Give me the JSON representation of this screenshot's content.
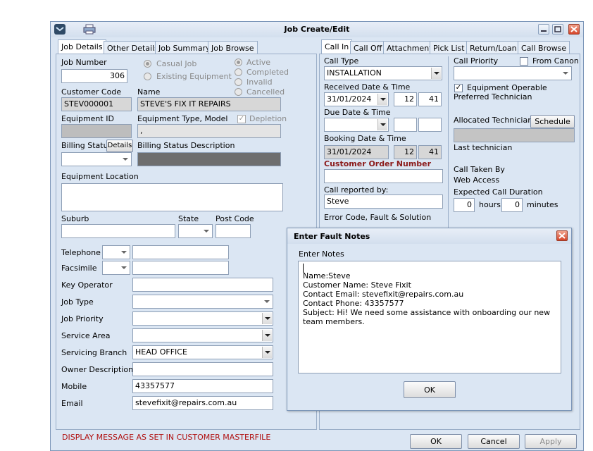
{
  "window": {
    "title": "Job Create/Edit"
  },
  "left_tabs": [
    "Job Details",
    "Other Details",
    "Job Summary",
    "Job Browse"
  ],
  "right_tabs": [
    "Call In",
    "Call Off",
    "Attachment",
    "Pick List",
    "Return/Loan",
    "Call Browse"
  ],
  "job": {
    "number_label": "Job Number",
    "number_value": "306",
    "job_kind": {
      "casual": "Casual Job",
      "existing": "Existing Equipment"
    },
    "status": {
      "active": "Active",
      "completed": "Completed",
      "invalid": "Invalid",
      "cancelled": "Cancelled"
    },
    "customer_code_label": "Customer Code",
    "customer_code_value": "STEV000001",
    "name_label": "Name",
    "name_value": "STEVE'S FIX IT REPAIRS",
    "equipment_id_label": "Equipment ID",
    "equipment_type_label": "Equipment Type, Model",
    "equipment_type_value": ",",
    "depletion_label": "Depletion",
    "billing_status_label": "Billing Status",
    "details_button": "Details",
    "billing_desc_label": "Billing Status Description",
    "equipment_location_label": "Equipment Location",
    "suburb_label": "Suburb",
    "state_label": "State",
    "postcode_label": "Post Code",
    "telephone_label": "Telephone",
    "facsimile_label": "Facsimile",
    "key_operator_label": "Key Operator",
    "job_type_label": "Job Type",
    "job_priority_label": "Job Priority",
    "service_area_label": "Service Area",
    "servicing_branch_label": "Servicing Branch",
    "servicing_branch_value": "HEAD OFFICE",
    "owner_desc_label": "Owner Description",
    "mobile_label": "Mobile",
    "mobile_value": "43357577",
    "email_label": "Email",
    "email_value": "stevefixit@repairs.com.au"
  },
  "call_in": {
    "call_type_label": "Call Type",
    "call_type_value": "INSTALLATION",
    "received_label": "Received Date & Time",
    "received_date": "31/01/2024",
    "received_hour": "12",
    "received_min": "41",
    "due_label": "Due Date & Time",
    "booking_label": "Booking Date & Time",
    "booking_date": "31/01/2024",
    "booking_hour": "12",
    "booking_min": "41",
    "customer_order_label": "Customer Order Number",
    "reported_by_label": "Call reported by:",
    "reported_by_value": "Steve",
    "error_code_label": "Error Code,  Fault & Solution",
    "call_priority_label": "Call Priority",
    "from_canon_label": "From Canon",
    "equipment_operable_label": "Equipment Operable",
    "preferred_tech_label": "Preferred Technician",
    "allocated_tech_label": "Allocated Technician",
    "schedule_button": "Schedule",
    "last_tech_label": "Last technician",
    "call_taken_by_label": "Call Taken By",
    "call_taken_by_value": "Web Access",
    "expected_duration_label": "Expected Call Duration",
    "hours_value": "0",
    "hours_label": "hours",
    "minutes_value": "0",
    "minutes_label": "minutes"
  },
  "footer": {
    "message": "DISPLAY MESSAGE AS SET IN CUSTOMER MASTERFILE",
    "ok": "OK",
    "cancel": "Cancel",
    "apply": "Apply"
  },
  "dialog": {
    "title": "Enter Fault Notes",
    "label": "Enter Notes",
    "lines": [
      "Name:Steve",
      "Customer Name: Steve Fixit",
      "Contact Email: stevefixit@repairs.com.au",
      "Contact Phone: 43357577",
      "Subject: Hi! We need some assistance with onboarding our new team members."
    ],
    "ok": "OK"
  }
}
